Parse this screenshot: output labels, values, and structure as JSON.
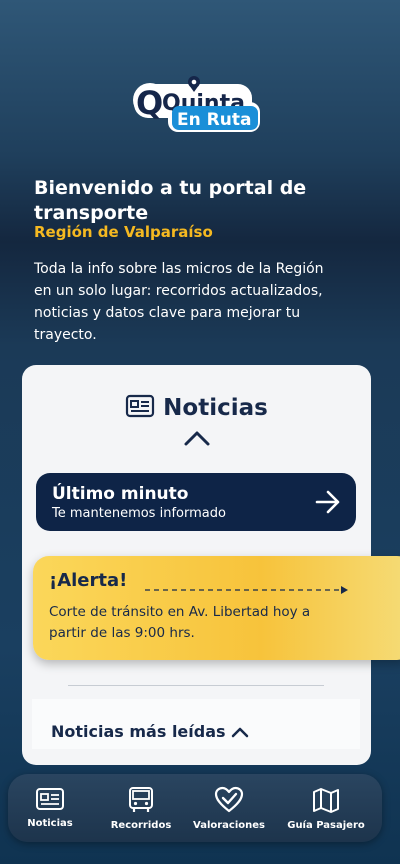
{
  "brand": {
    "logo_line1": "Quinta",
    "logo_line2": "En Ruta"
  },
  "hero": {
    "title": "Bienvenido a tu portal de transporte",
    "region": "Región de Valparaíso",
    "description": "Toda la info sobre las micros de la Región en un solo lugar: recorridos actualizados, noticias y datos clave para mejorar tu trayecto."
  },
  "news": {
    "title": "Noticias",
    "last_minute": {
      "title": "Último minuto",
      "subtitle": "Te mantenemos informado"
    },
    "alert": {
      "title": "¡Alerta!",
      "body": "Corte de tránsito en Av. Libertad hoy a partir de las 9:00 hrs."
    },
    "most_read_label": "Noticias más leídas"
  },
  "nav": {
    "items": [
      {
        "label": "Noticias",
        "icon": "newspaper-icon"
      },
      {
        "label": "Recorridos",
        "icon": "bus-icon"
      },
      {
        "label": "Valoraciones",
        "icon": "heart-check-icon"
      },
      {
        "label": "Guía Pasajero",
        "icon": "map-icon"
      }
    ]
  },
  "colors": {
    "accent": "#f5b921",
    "navy": "#0e2447",
    "card": "#f4f5f7"
  }
}
